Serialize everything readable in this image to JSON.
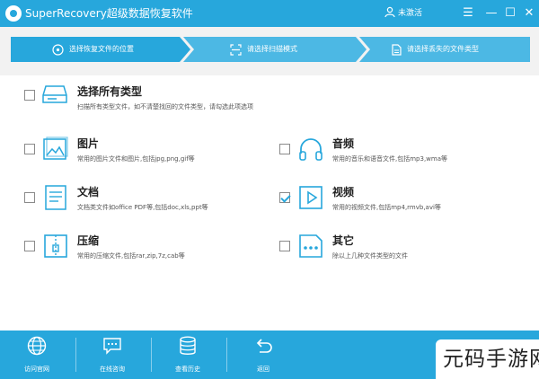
{
  "window": {
    "title": "SuperRecovery超级数据恢复软件",
    "user_label": "未激活",
    "menu_glyph": "☰",
    "min_glyph": "—",
    "max_glyph": "☐",
    "close_glyph": "✕"
  },
  "steps": [
    {
      "label": "选择恢复文件的位置",
      "icon": "disk-icon",
      "active": true
    },
    {
      "label": "请选择扫描模式",
      "icon": "scan-icon",
      "active": false
    },
    {
      "label": "请选择丢失的文件类型",
      "icon": "file-icon",
      "active": false
    }
  ],
  "all_types": {
    "title": "选择所有类型",
    "desc": "扫描所有类型文件，如不清楚找回的文件类型，请勾选此项选项",
    "checked": false,
    "icon": "drive-icon"
  },
  "types": [
    {
      "key": "image",
      "title": "图片",
      "desc": "常用的图片文件和图片,包括jpg,png,gif等",
      "checked": false,
      "icon": "image-icon"
    },
    {
      "key": "audio",
      "title": "音频",
      "desc": "常用的音乐和语音文件,包括mp3,wma等",
      "checked": false,
      "icon": "headphones-icon"
    },
    {
      "key": "document",
      "title": "文档",
      "desc": "文档类文件如office PDF等,包括doc,xls,ppt等",
      "checked": false,
      "icon": "document-icon"
    },
    {
      "key": "video",
      "title": "视频",
      "desc": "常用的视频文件,包括mp4,rmvb,avi等",
      "checked": true,
      "icon": "video-icon"
    },
    {
      "key": "archive",
      "title": "压缩",
      "desc": "常用的压缩文件,包括rar,zip,7z,cab等",
      "checked": false,
      "icon": "archive-icon"
    },
    {
      "key": "other",
      "title": "其它",
      "desc": "除以上几种文件类型的文件",
      "checked": false,
      "icon": "other-icon"
    }
  ],
  "bottom": [
    {
      "label": "访问官网",
      "icon": "globe-icon"
    },
    {
      "label": "在线咨询",
      "icon": "chat-icon"
    },
    {
      "label": "查看历史",
      "icon": "database-icon"
    },
    {
      "label": "返回",
      "icon": "back-arrow-icon"
    }
  ],
  "watermark": "元码手游网",
  "colors": {
    "accent": "#27a7dc",
    "step_active": "#27a7dc",
    "step_inactive": "#4cb8e4",
    "icon_stroke": "#27a7dc"
  }
}
